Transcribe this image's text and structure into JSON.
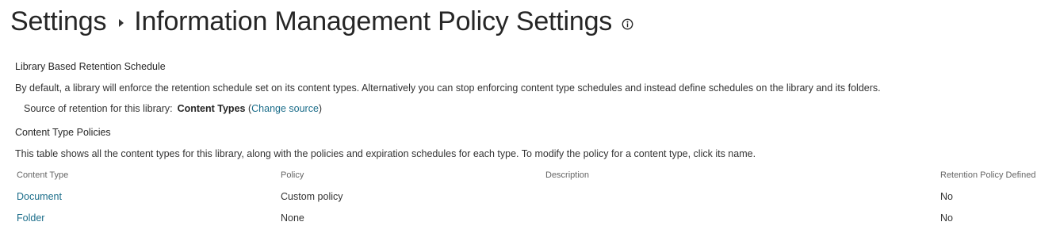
{
  "header": {
    "crumb_root": "Settings",
    "crumb_current": "Information Management Policy Settings",
    "info_icon": "info-circle-icon"
  },
  "retention": {
    "heading": "Library Based Retention Schedule",
    "description": "By default, a library will enforce the retention schedule set on its content types. Alternatively you can stop enforcing content type schedules and instead define schedules on the library and its folders.",
    "source_label": "Source of retention for this library:",
    "source_value": "Content Types",
    "open_paren": "(",
    "change_link": "Change source",
    "close_paren": ")"
  },
  "policies": {
    "heading": "Content Type Policies",
    "description": "This table shows all the content types for this library, along with the policies and expiration schedules for each type. To modify the policy for a content type, click its name.",
    "columns": [
      "Content Type",
      "Policy",
      "Description",
      "Retention Policy Defined"
    ],
    "rows": [
      {
        "content_type": "Document",
        "policy": "Custom policy",
        "description": "",
        "retention": "No"
      },
      {
        "content_type": "Folder",
        "policy": "None",
        "description": "",
        "retention": "No"
      }
    ]
  },
  "colors": {
    "link": "#1b6d8a",
    "text": "#333333",
    "muted": "#666666"
  }
}
